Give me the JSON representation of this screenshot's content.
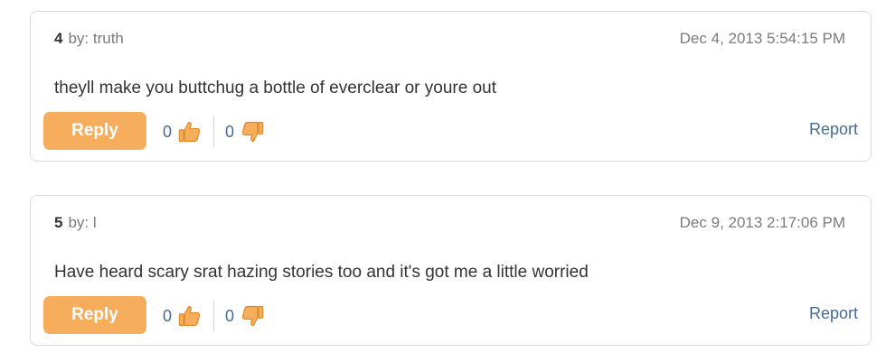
{
  "comments": [
    {
      "number": "4",
      "author": "by: truth",
      "date": "Dec 4, 2013 5:54:15 PM",
      "text": "theyll make you buttchug a bottle of everclear or youre out",
      "reply_label": "Reply",
      "upvotes": "0",
      "downvotes": "0",
      "report_label": "Report"
    },
    {
      "number": "5",
      "author": "by: l",
      "date": "Dec 9, 2013 2:17:06 PM",
      "text": "Have heard scary srat hazing stories too and it's got me a little worried",
      "reply_label": "Reply",
      "upvotes": "0",
      "downvotes": "0",
      "report_label": "Report"
    }
  ],
  "icons": {
    "upvote": "thumbs-up-icon",
    "downvote": "thumbs-down-icon"
  },
  "colors": {
    "reply_button": "#f6ae5c",
    "link": "#446b96",
    "thumb": "#f6ae5c"
  }
}
